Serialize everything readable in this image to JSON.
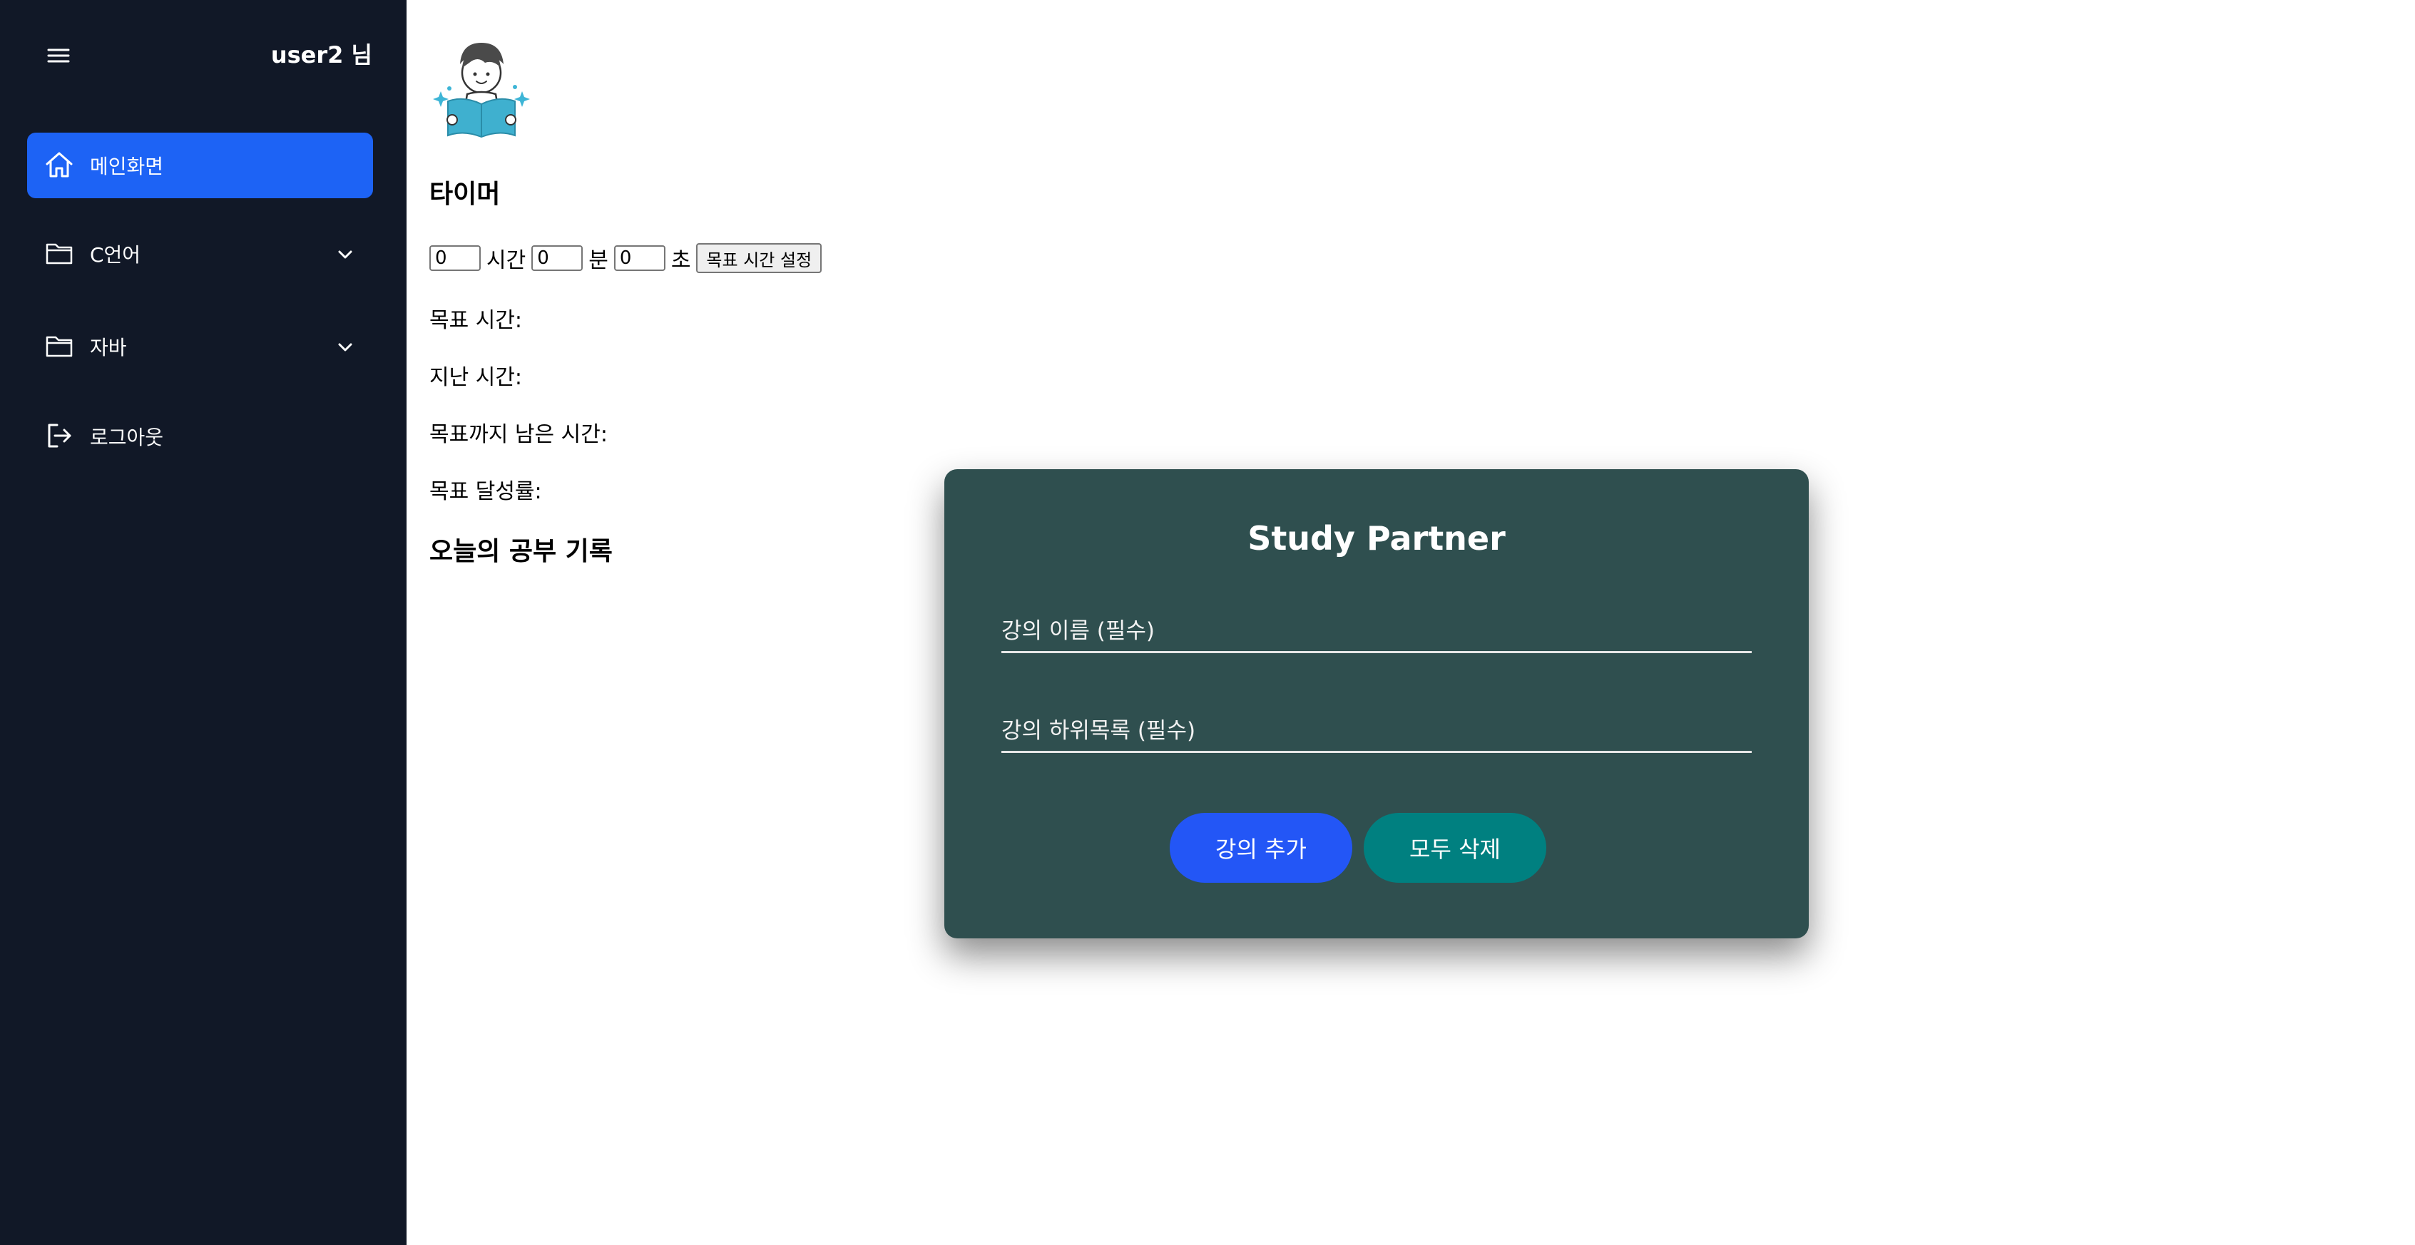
{
  "sidebar": {
    "user_name": "user2 님",
    "items": [
      {
        "label": "메인화면",
        "icon": "home-icon",
        "active": true
      },
      {
        "label": "C언어",
        "icon": "folder-icon",
        "expandable": true
      },
      {
        "label": "자바",
        "icon": "folder-icon",
        "expandable": true
      },
      {
        "label": "로그아웃",
        "icon": "logout-icon"
      }
    ]
  },
  "main": {
    "timer_heading": "타이머",
    "timer": {
      "hours_value": "0",
      "hours_unit": "시간",
      "minutes_value": "0",
      "minutes_unit": "분",
      "seconds_value": "0",
      "seconds_unit": "초",
      "set_button": "목표 시간 설정"
    },
    "stats": {
      "target_time": "목표 시간:",
      "elapsed_time": "지난 시간:",
      "remaining_time": "목표까지 남은 시간:",
      "achievement_rate": "목표 달성률:"
    },
    "today_heading": "오늘의 공부 기록"
  },
  "modal": {
    "title": "Study Partner",
    "course_name_placeholder": "강의 이름 (필수)",
    "course_sub_placeholder": "강의 하위목록 (필수)",
    "add_button": "강의 추가",
    "clear_button": "모두 삭제"
  },
  "colors": {
    "sidebar_bg": "#111827",
    "active_item": "#1d63f5",
    "modal_bg": "#2f4f4f",
    "add_button": "#2356f6",
    "clear_button": "#008080"
  }
}
